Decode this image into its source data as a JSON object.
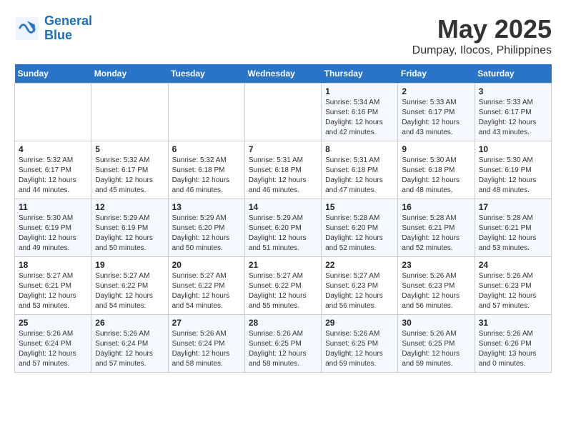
{
  "logo": {
    "line1": "General",
    "line2": "Blue"
  },
  "title": "May 2025",
  "subtitle": "Dumpay, Ilocos, Philippines",
  "weekdays": [
    "Sunday",
    "Monday",
    "Tuesday",
    "Wednesday",
    "Thursday",
    "Friday",
    "Saturday"
  ],
  "weeks": [
    [
      {
        "day": "",
        "info": ""
      },
      {
        "day": "",
        "info": ""
      },
      {
        "day": "",
        "info": ""
      },
      {
        "day": "",
        "info": ""
      },
      {
        "day": "1",
        "info": "Sunrise: 5:34 AM\nSunset: 6:16 PM\nDaylight: 12 hours\nand 42 minutes."
      },
      {
        "day": "2",
        "info": "Sunrise: 5:33 AM\nSunset: 6:17 PM\nDaylight: 12 hours\nand 43 minutes."
      },
      {
        "day": "3",
        "info": "Sunrise: 5:33 AM\nSunset: 6:17 PM\nDaylight: 12 hours\nand 43 minutes."
      }
    ],
    [
      {
        "day": "4",
        "info": "Sunrise: 5:32 AM\nSunset: 6:17 PM\nDaylight: 12 hours\nand 44 minutes."
      },
      {
        "day": "5",
        "info": "Sunrise: 5:32 AM\nSunset: 6:17 PM\nDaylight: 12 hours\nand 45 minutes."
      },
      {
        "day": "6",
        "info": "Sunrise: 5:32 AM\nSunset: 6:18 PM\nDaylight: 12 hours\nand 46 minutes."
      },
      {
        "day": "7",
        "info": "Sunrise: 5:31 AM\nSunset: 6:18 PM\nDaylight: 12 hours\nand 46 minutes."
      },
      {
        "day": "8",
        "info": "Sunrise: 5:31 AM\nSunset: 6:18 PM\nDaylight: 12 hours\nand 47 minutes."
      },
      {
        "day": "9",
        "info": "Sunrise: 5:30 AM\nSunset: 6:18 PM\nDaylight: 12 hours\nand 48 minutes."
      },
      {
        "day": "10",
        "info": "Sunrise: 5:30 AM\nSunset: 6:19 PM\nDaylight: 12 hours\nand 48 minutes."
      }
    ],
    [
      {
        "day": "11",
        "info": "Sunrise: 5:30 AM\nSunset: 6:19 PM\nDaylight: 12 hours\nand 49 minutes."
      },
      {
        "day": "12",
        "info": "Sunrise: 5:29 AM\nSunset: 6:19 PM\nDaylight: 12 hours\nand 50 minutes."
      },
      {
        "day": "13",
        "info": "Sunrise: 5:29 AM\nSunset: 6:20 PM\nDaylight: 12 hours\nand 50 minutes."
      },
      {
        "day": "14",
        "info": "Sunrise: 5:29 AM\nSunset: 6:20 PM\nDaylight: 12 hours\nand 51 minutes."
      },
      {
        "day": "15",
        "info": "Sunrise: 5:28 AM\nSunset: 6:20 PM\nDaylight: 12 hours\nand 52 minutes."
      },
      {
        "day": "16",
        "info": "Sunrise: 5:28 AM\nSunset: 6:21 PM\nDaylight: 12 hours\nand 52 minutes."
      },
      {
        "day": "17",
        "info": "Sunrise: 5:28 AM\nSunset: 6:21 PM\nDaylight: 12 hours\nand 53 minutes."
      }
    ],
    [
      {
        "day": "18",
        "info": "Sunrise: 5:27 AM\nSunset: 6:21 PM\nDaylight: 12 hours\nand 53 minutes."
      },
      {
        "day": "19",
        "info": "Sunrise: 5:27 AM\nSunset: 6:22 PM\nDaylight: 12 hours\nand 54 minutes."
      },
      {
        "day": "20",
        "info": "Sunrise: 5:27 AM\nSunset: 6:22 PM\nDaylight: 12 hours\nand 54 minutes."
      },
      {
        "day": "21",
        "info": "Sunrise: 5:27 AM\nSunset: 6:22 PM\nDaylight: 12 hours\nand 55 minutes."
      },
      {
        "day": "22",
        "info": "Sunrise: 5:27 AM\nSunset: 6:23 PM\nDaylight: 12 hours\nand 56 minutes."
      },
      {
        "day": "23",
        "info": "Sunrise: 5:26 AM\nSunset: 6:23 PM\nDaylight: 12 hours\nand 56 minutes."
      },
      {
        "day": "24",
        "info": "Sunrise: 5:26 AM\nSunset: 6:23 PM\nDaylight: 12 hours\nand 57 minutes."
      }
    ],
    [
      {
        "day": "25",
        "info": "Sunrise: 5:26 AM\nSunset: 6:24 PM\nDaylight: 12 hours\nand 57 minutes."
      },
      {
        "day": "26",
        "info": "Sunrise: 5:26 AM\nSunset: 6:24 PM\nDaylight: 12 hours\nand 57 minutes."
      },
      {
        "day": "27",
        "info": "Sunrise: 5:26 AM\nSunset: 6:24 PM\nDaylight: 12 hours\nand 58 minutes."
      },
      {
        "day": "28",
        "info": "Sunrise: 5:26 AM\nSunset: 6:25 PM\nDaylight: 12 hours\nand 58 minutes."
      },
      {
        "day": "29",
        "info": "Sunrise: 5:26 AM\nSunset: 6:25 PM\nDaylight: 12 hours\nand 59 minutes."
      },
      {
        "day": "30",
        "info": "Sunrise: 5:26 AM\nSunset: 6:25 PM\nDaylight: 12 hours\nand 59 minutes."
      },
      {
        "day": "31",
        "info": "Sunrise: 5:26 AM\nSunset: 6:26 PM\nDaylight: 13 hours\nand 0 minutes."
      }
    ]
  ]
}
